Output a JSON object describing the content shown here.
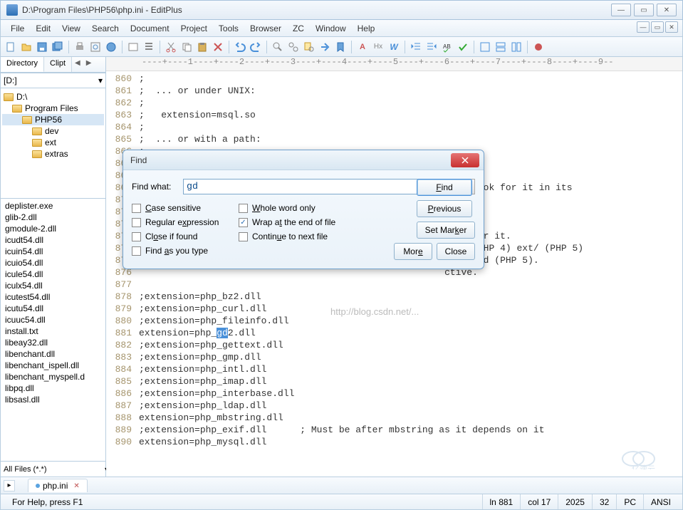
{
  "window": {
    "title": "D:\\Program Files\\PHP56\\php.ini - EditPlus"
  },
  "menu": {
    "items": [
      "File",
      "Edit",
      "View",
      "Search",
      "Document",
      "Project",
      "Tools",
      "Browser",
      "ZC",
      "Window",
      "Help"
    ]
  },
  "sidebar": {
    "tabs": {
      "directory": "Directory",
      "cliptext": "Clipt"
    },
    "drive": "[D:]",
    "tree": [
      {
        "label": "D:\\",
        "indent": 0
      },
      {
        "label": "Program Files",
        "indent": 1
      },
      {
        "label": "PHP56",
        "indent": 2,
        "selected": true
      },
      {
        "label": "dev",
        "indent": 3
      },
      {
        "label": "ext",
        "indent": 3
      },
      {
        "label": "extras",
        "indent": 3
      }
    ],
    "files": [
      "deplister.exe",
      "glib-2.dll",
      "gmodule-2.dll",
      "icudt54.dll",
      "icuin54.dll",
      "icuio54.dll",
      "icule54.dll",
      "iculx54.dll",
      "icutest54.dll",
      "icutu54.dll",
      "icuuc54.dll",
      "install.txt",
      "libeay32.dll",
      "libenchant.dll",
      "libenchant_ispell.dll",
      "libenchant_myspell.d",
      "libpq.dll",
      "libsasl.dll"
    ],
    "filter": "All Files (*.*)"
  },
  "editor": {
    "ruler": "----+----1----+----2----+----3----+----4----+----5----+----6----+----7----+----8----+----9--",
    "lines": [
      {
        "n": 860,
        "t": ";"
      },
      {
        "n": 861,
        "t": ";  ... or under UNIX:"
      },
      {
        "n": 862,
        "t": ";"
      },
      {
        "n": 863,
        "t": ";   extension=msql.so"
      },
      {
        "n": 864,
        "t": ";"
      },
      {
        "n": 865,
        "t": ";  ... or with a path:"
      },
      {
        "n": 866,
        "t": ";"
      },
      {
        "n": 867,
        "t": ""
      },
      {
        "n": 868,
        "t": ""
      },
      {
        "n": 869,
        "t": "                                                       will look for it in its"
      },
      {
        "n": 870,
        "t": ""
      },
      {
        "n": 871,
        "t": ""
      },
      {
        "n": 872,
        "t": ""
      },
      {
        "n": 873,
        "t": "                                                       eded for it."
      },
      {
        "n": 874,
        "t": "                                                       ons/ (PHP 4) ext/ (PHP 5)"
      },
      {
        "n": 875,
        "t": "                                                       download (PHP 5)."
      },
      {
        "n": 876,
        "t": "                                                       ctive."
      },
      {
        "n": 877,
        "t": ""
      },
      {
        "n": 878,
        "t": ";extension=php_bz2.dll"
      },
      {
        "n": 879,
        "t": ";extension=php_curl.dll"
      },
      {
        "n": 880,
        "t": ";extension=php_fileinfo.dll"
      },
      {
        "n": 881,
        "t": "extension=php_",
        "hl": "gd",
        "t2": "2.dll"
      },
      {
        "n": 882,
        "t": ";extension=php_gettext.dll"
      },
      {
        "n": 883,
        "t": ";extension=php_gmp.dll"
      },
      {
        "n": 884,
        "t": ";extension=php_intl.dll"
      },
      {
        "n": 885,
        "t": ";extension=php_imap.dll"
      },
      {
        "n": 886,
        "t": ";extension=php_interbase.dll"
      },
      {
        "n": 887,
        "t": ";extension=php_ldap.dll"
      },
      {
        "n": 888,
        "t": "extension=php_mbstring.dll"
      },
      {
        "n": 889,
        "t": ";extension=php_exif.dll      ; Must be after mbstring as it depends on it"
      },
      {
        "n": 890,
        "t": "extension=php_mysql.dll"
      }
    ]
  },
  "find": {
    "title": "Find",
    "findWhatLabel": "Find what:",
    "findWhatValue": "gd",
    "opts": {
      "caseSensitive": "Case sensitive",
      "regex": "Regular expression",
      "closeIfFound": "Close if found",
      "findAsType": "Find as you type",
      "wholeWord": "Whole word only",
      "wrap": "Wrap at the end of file",
      "continue": "Continue to next file"
    },
    "checked": {
      "wrap": true
    },
    "buttons": {
      "find": "Find",
      "previous": "Previous",
      "setMarker": "Set Marker",
      "more": "More",
      "close": "Close"
    }
  },
  "docTabs": {
    "file": "php.ini"
  },
  "status": {
    "help": "For Help, press F1",
    "line": "ln 881",
    "col": "col 17",
    "total": "2025",
    "sel": "32",
    "mode": "PC",
    "enc": "ANSI"
  },
  "watermark": "亿速云"
}
